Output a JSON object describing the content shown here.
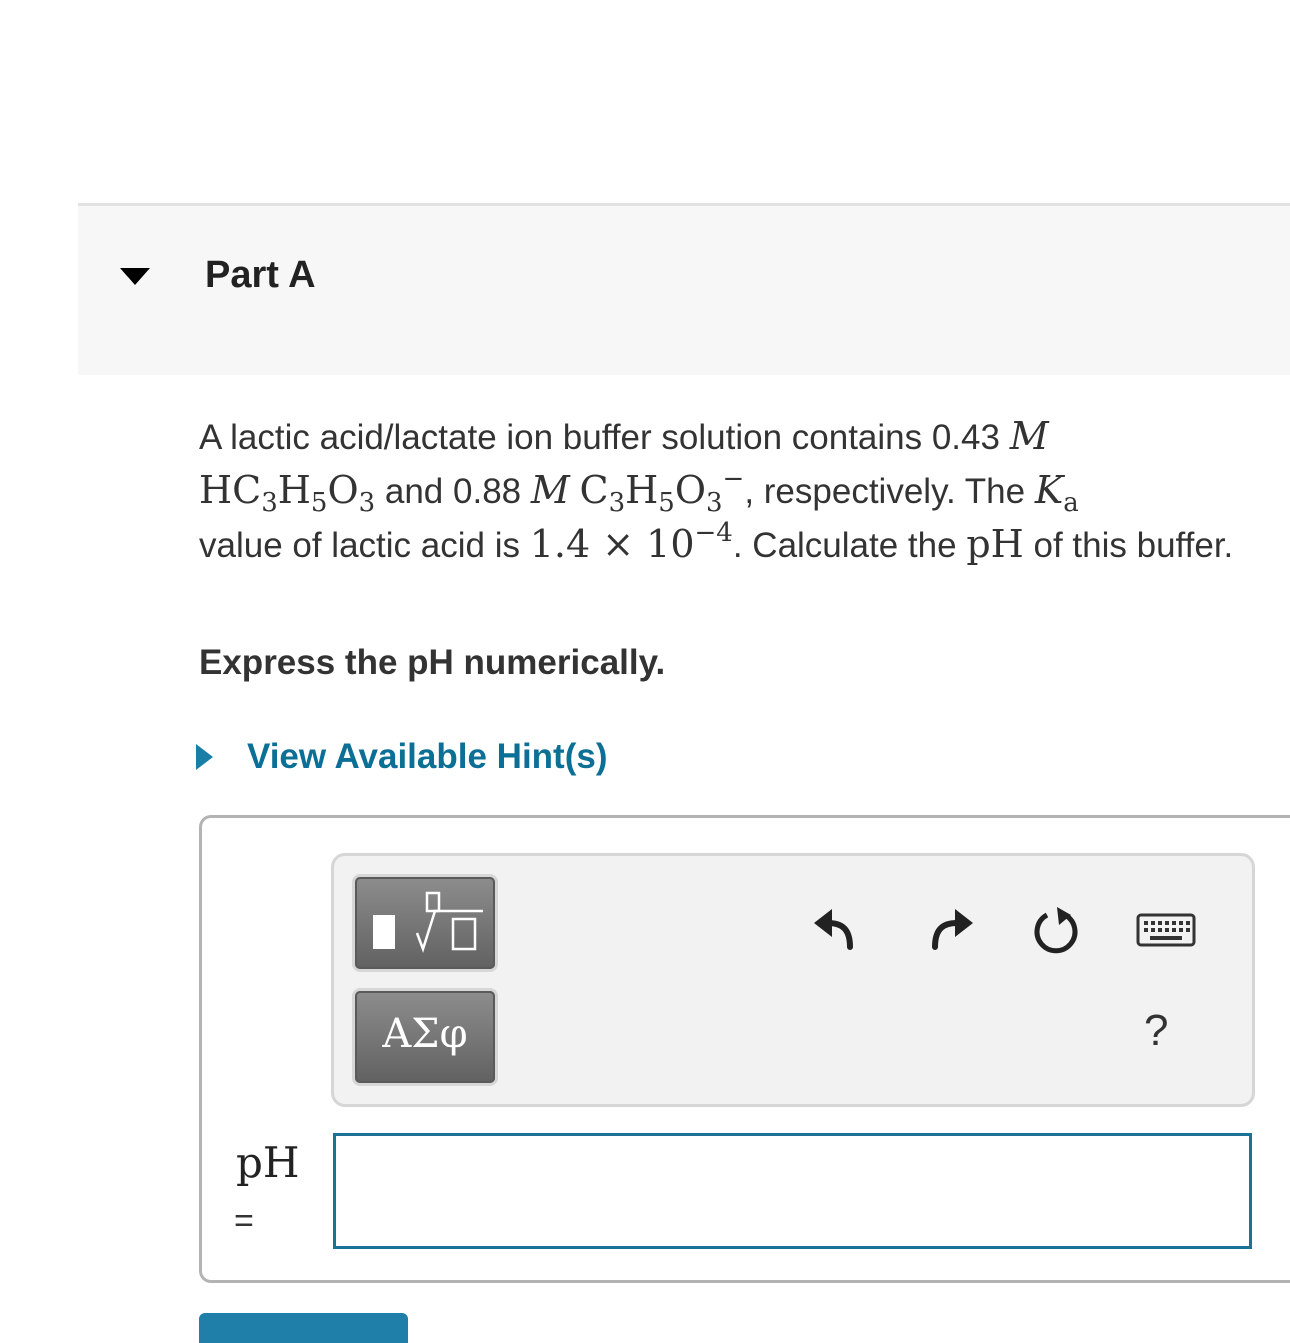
{
  "part": {
    "title": "Part A"
  },
  "problem": {
    "t1": "A lactic acid/lactate ion buffer solution contains 0.43 ",
    "unit_m": "M",
    "hc": "HC",
    "s3": "3",
    "h": "H",
    "s5": "5",
    "o": "O",
    "t2": " and 0.88 ",
    "c": "C",
    "minus": "−",
    "t3": ", respectively. The ",
    "k": "K",
    "ka_sub": "a",
    "t4": " value of lactic acid is ",
    "value": "1.4 × 10",
    "exp": "−4",
    "t5": ". Calculate the ",
    "ph": "pH",
    "t6": " of this buffer."
  },
  "instruction": "Express the pH numerically.",
  "hint": {
    "label": "View Available Hint(s)"
  },
  "toolbar": {
    "greek_label": "ΑΣφ",
    "help_label": "?",
    "icons": [
      "templates-icon",
      "greek-symbols-icon",
      "undo-icon",
      "redo-icon",
      "reset-icon",
      "keyboard-icon",
      "help-icon"
    ]
  },
  "answer": {
    "variable": "pH",
    "equals": "=",
    "value": ""
  },
  "colors": {
    "accent": "#0c6f95",
    "input_border": "#1a7396",
    "header_bg": "#f7f7f7"
  }
}
